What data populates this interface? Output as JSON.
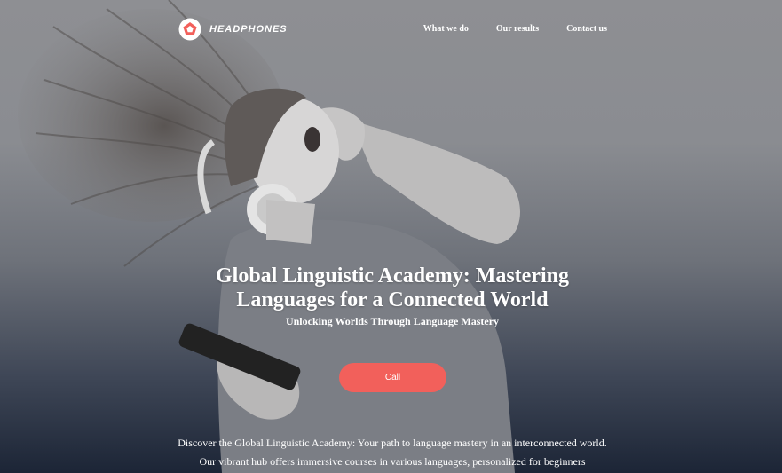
{
  "brand": {
    "name": "HEADPHONES",
    "icon": "pentagon-logo-icon",
    "accent_color": "#f2605b"
  },
  "nav": {
    "items": [
      {
        "label": "What we do"
      },
      {
        "label": "Our results"
      },
      {
        "label": "Contact us"
      }
    ]
  },
  "hero": {
    "title": "Global Linguistic Academy: Mastering Languages for a Connected World",
    "subtitle": "Unlocking Worlds Through Language Mastery",
    "cta_label": "Call",
    "cta_color": "#f2605b",
    "image": "woman-with-headphones-photo"
  },
  "intro": {
    "text": "Discover the Global Linguistic Academy: Your path to language mastery in an interconnected world. Our vibrant hub offers immersive courses in various languages, personalized for beginners"
  }
}
